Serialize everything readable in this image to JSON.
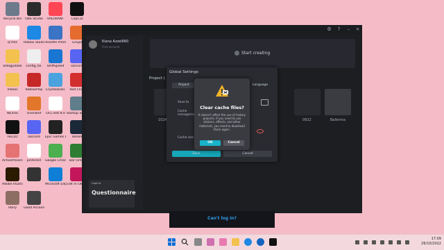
{
  "desktop_icons": [
    {
      "label": "Recycle Bin",
      "color": "#6d7a8c"
    },
    {
      "label": "OBS Studio",
      "color": "#2b2b2b"
    },
    {
      "label": "VALORANT",
      "color": "#ff4655"
    },
    {
      "label": "CapCut",
      "color": "#111111"
    },
    {
      "label": "q’mes",
      "color": "#ffffff"
    },
    {
      "label": "Roblox Studio",
      "color": "#1e88e5"
    },
    {
      "label": "Assetto Premente",
      "color": "#3b73c5"
    },
    {
      "label": "Grupo",
      "color": "#e66b2e"
    },
    {
      "label": "aldagjsdakk",
      "color": "#f2c14e"
    },
    {
      "label": "config_fol.",
      "color": "#eeeeee"
    },
    {
      "label": "ShiftSpeed",
      "color": "#1976d2"
    },
    {
      "label": "Discord",
      "color": "#5865f2"
    },
    {
      "label": "Videos",
      "color": "#f2c14e"
    },
    {
      "label": "RobloxPlay",
      "color": "#c62828"
    },
    {
      "label": "CrystalDiskI.",
      "color": "#4aa3df"
    },
    {
      "label": "Red Chat",
      "color": "#d32f2f"
    },
    {
      "label": "NEXUS",
      "color": "#ffffff"
    },
    {
      "label": "Overwolf",
      "color": "#e2762a"
    },
    {
      "label": "OCCTest 8.0",
      "color": "#ffffff"
    },
    {
      "label": "Startup Select",
      "color": "#607d8b"
    },
    {
      "label": "HELLO",
      "color": "#111111"
    },
    {
      "label": "Discord",
      "color": "#5865f2"
    },
    {
      "label": "Epic Games Launcher",
      "color": "#222222"
    },
    {
      "label": "Steam",
      "color": "#1b2838"
    },
    {
      "label": "ActivePresen.",
      "color": "#e57373"
    },
    {
      "label": "pinterest",
      "color": "#ffffff"
    },
    {
      "label": "Google Chrome",
      "color": "#4caf50"
    },
    {
      "label": "Bar Ord 4",
      "color": "#2e7d32"
    },
    {
      "label": "Adobe Illustrator",
      "color": "#2a1a00"
    },
    {
      "label": "",
      "color": "#333333"
    },
    {
      "label": "Microsoft Edge",
      "color": "#0e7fd6"
    },
    {
      "label": "Edit In OBS Studio",
      "color": "#c2185b"
    },
    {
      "label": "Story",
      "color": "#8d6e63"
    },
    {
      "label": "Good Accounts",
      "color": "#444444"
    }
  ],
  "app": {
    "user": {
      "name": "Kiana Azzel660",
      "sub": "Free account"
    },
    "start_label": "Start creating",
    "projects_title": "Project (",
    "tiles": [
      {
        "label": "1024"
      },
      {
        "label": "0922"
      },
      {
        "label": "Ballerina"
      }
    ],
    "promo": {
      "small": "CapCut",
      "big": "Questionnaire"
    }
  },
  "settings": {
    "title": "Global Settings",
    "tabs": [
      "Project",
      "Language"
    ],
    "rows": [
      "Save to",
      "Cache management",
      "Cache size"
    ],
    "save_label": "Save",
    "cancel_label": "Cancel"
  },
  "dialog": {
    "title": "Clear cache files?",
    "body": "It doesn't affect the use of history projects. If you need to use stickers, effects, and other materials, you need to download them again.",
    "ok_label": "OK",
    "cancel_label": "Cancel"
  },
  "login": {
    "link": "Can't log in?"
  },
  "taskbar": {
    "time": "17:09",
    "date": "26/10/2022"
  },
  "colors": {
    "accent": "#19b4c8",
    "dialog_bg": "#3a3b41",
    "app_bg": "#1d1e22",
    "desktop": "#f5bcc8"
  }
}
